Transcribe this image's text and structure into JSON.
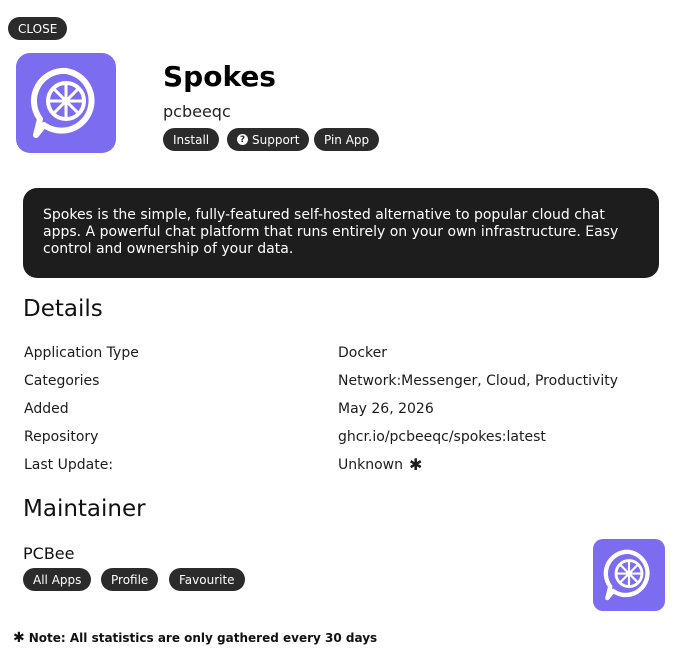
{
  "header": {
    "close_label": "CLOSE",
    "app_name": "Spokes",
    "author": "pcbeeqc",
    "actions": {
      "install_label": "Install",
      "support_label": "Support",
      "pin_label": "Pin App"
    },
    "icon": "wheel-chat-icon",
    "icon_color": "#7b6cf0"
  },
  "description": "Spokes is the simple, fully-featured self-hosted alternative to popular cloud chat apps. A powerful chat platform that runs entirely on your own infrastructure. Easy control and ownership of your data.",
  "details": {
    "heading": "Details",
    "rows": [
      {
        "label": "Application Type",
        "value": "Docker"
      },
      {
        "label": "Categories",
        "value": "Network:Messenger, Cloud, Productivity"
      },
      {
        "label": "Added",
        "value": "May 26, 2026"
      },
      {
        "label": "Repository",
        "value": "ghcr.io/pcbeeqc/spokes:latest"
      },
      {
        "label": "Last Update:",
        "value": "Unknown"
      }
    ]
  },
  "maintainer": {
    "heading": "Maintainer",
    "name": "PCBee",
    "actions": {
      "all_apps_label": "All Apps",
      "profile_label": "Profile",
      "favourite_label": "Favourite"
    }
  },
  "footnote": "Note: All statistics are only gathered every 30 days"
}
